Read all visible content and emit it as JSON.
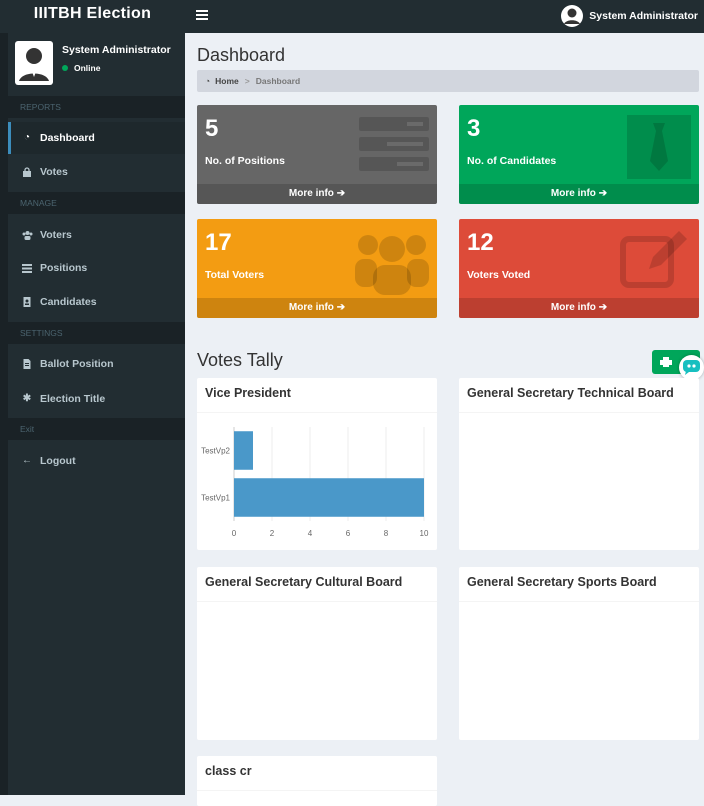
{
  "app": {
    "title": "IIITBH Election",
    "user_name": "System Administrator",
    "user_status": "Online"
  },
  "sidebar": {
    "sections": {
      "reports": "REPORTS",
      "manage": "MANAGE",
      "settings": "SETTINGS",
      "exit": "Exit"
    },
    "items": [
      {
        "label": "Dashboard",
        "icon": "dashboard-icon",
        "active": true
      },
      {
        "label": "Votes",
        "icon": "lock-icon"
      },
      {
        "label": "Voters",
        "icon": "users-icon"
      },
      {
        "label": "Positions",
        "icon": "list-icon"
      },
      {
        "label": "Candidates",
        "icon": "id-badge-icon"
      },
      {
        "label": "Ballot Position",
        "icon": "file-icon"
      },
      {
        "label": "Election Title",
        "icon": "gear-icon"
      },
      {
        "label": "Logout",
        "icon": "arrow-left-icon"
      }
    ]
  },
  "main": {
    "page_title": "Dashboard",
    "breadcrumb": {
      "home": "Home",
      "current": "Dashboard"
    },
    "stats": [
      {
        "value": "5",
        "label": "No. of Positions",
        "more": "More info",
        "color": "#666666"
      },
      {
        "value": "3",
        "label": "No. of Candidates",
        "more": "More info",
        "color": "#00a65a"
      },
      {
        "value": "17",
        "label": "Total Voters",
        "more": "More info",
        "color": "#f39c12"
      },
      {
        "value": "12",
        "label": "Voters Voted",
        "more": "More info",
        "color": "#dd4b39"
      }
    ],
    "tally_title": "Votes Tally",
    "panels": [
      {
        "title": "Vice President"
      },
      {
        "title": "General Secretary Technical Board"
      },
      {
        "title": "General Secretary Cultural Board"
      },
      {
        "title": "General Secretary Sports Board"
      },
      {
        "title": "class cr"
      }
    ]
  },
  "chart_data": {
    "type": "bar",
    "orientation": "horizontal",
    "categories": [
      "TestVp2",
      "TestVp1"
    ],
    "values": [
      1,
      10
    ],
    "xlim": [
      0,
      10
    ],
    "xticks": [
      "0",
      "2",
      "4",
      "6",
      "8",
      "10"
    ],
    "color": "#4a98c9"
  }
}
